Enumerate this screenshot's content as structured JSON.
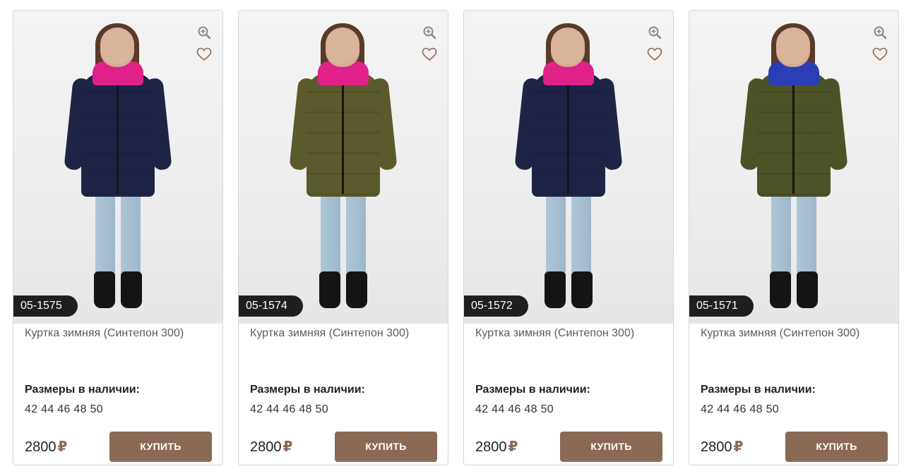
{
  "products": [
    {
      "sku": "05-1575",
      "title": "Куртка зимняя (Синтепон 300)",
      "sizes_label": "Размеры в наличии:",
      "sizes": "42 44 46 48 50",
      "price": "2800",
      "currency": "₽",
      "buy_label": "КУПИТЬ",
      "coat_color": "#1f2447",
      "collar_color": "#e0218a"
    },
    {
      "sku": "05-1574",
      "title": "Куртка зимняя (Синтепон 300)",
      "sizes_label": "Размеры в наличии:",
      "sizes": "42 44 46 48 50",
      "price": "2800",
      "currency": "₽",
      "buy_label": "КУПИТЬ",
      "coat_color": "#5b5a2c",
      "collar_color": "#e0218a"
    },
    {
      "sku": "05-1572",
      "title": "Куртка зимняя (Синтепон 300)",
      "sizes_label": "Размеры в наличии:",
      "sizes": "42 44 46 48 50",
      "price": "2800",
      "currency": "₽",
      "buy_label": "КУПИТЬ",
      "coat_color": "#1f2447",
      "collar_color": "#e0218a"
    },
    {
      "sku": "05-1571",
      "title": "Куртка зимняя (Синтепон 300)",
      "sizes_label": "Размеры в наличии:",
      "sizes": "42 44 46 48 50",
      "price": "2800",
      "currency": "₽",
      "buy_label": "КУПИТЬ",
      "coat_color": "#4c5327",
      "collar_color": "#2a3fb5"
    }
  ],
  "icons": {
    "zoom": "zoom-in-icon",
    "favorite": "heart-icon"
  },
  "colors": {
    "accent": "#8b6a55",
    "sku_badge": "#1f1f1f"
  }
}
